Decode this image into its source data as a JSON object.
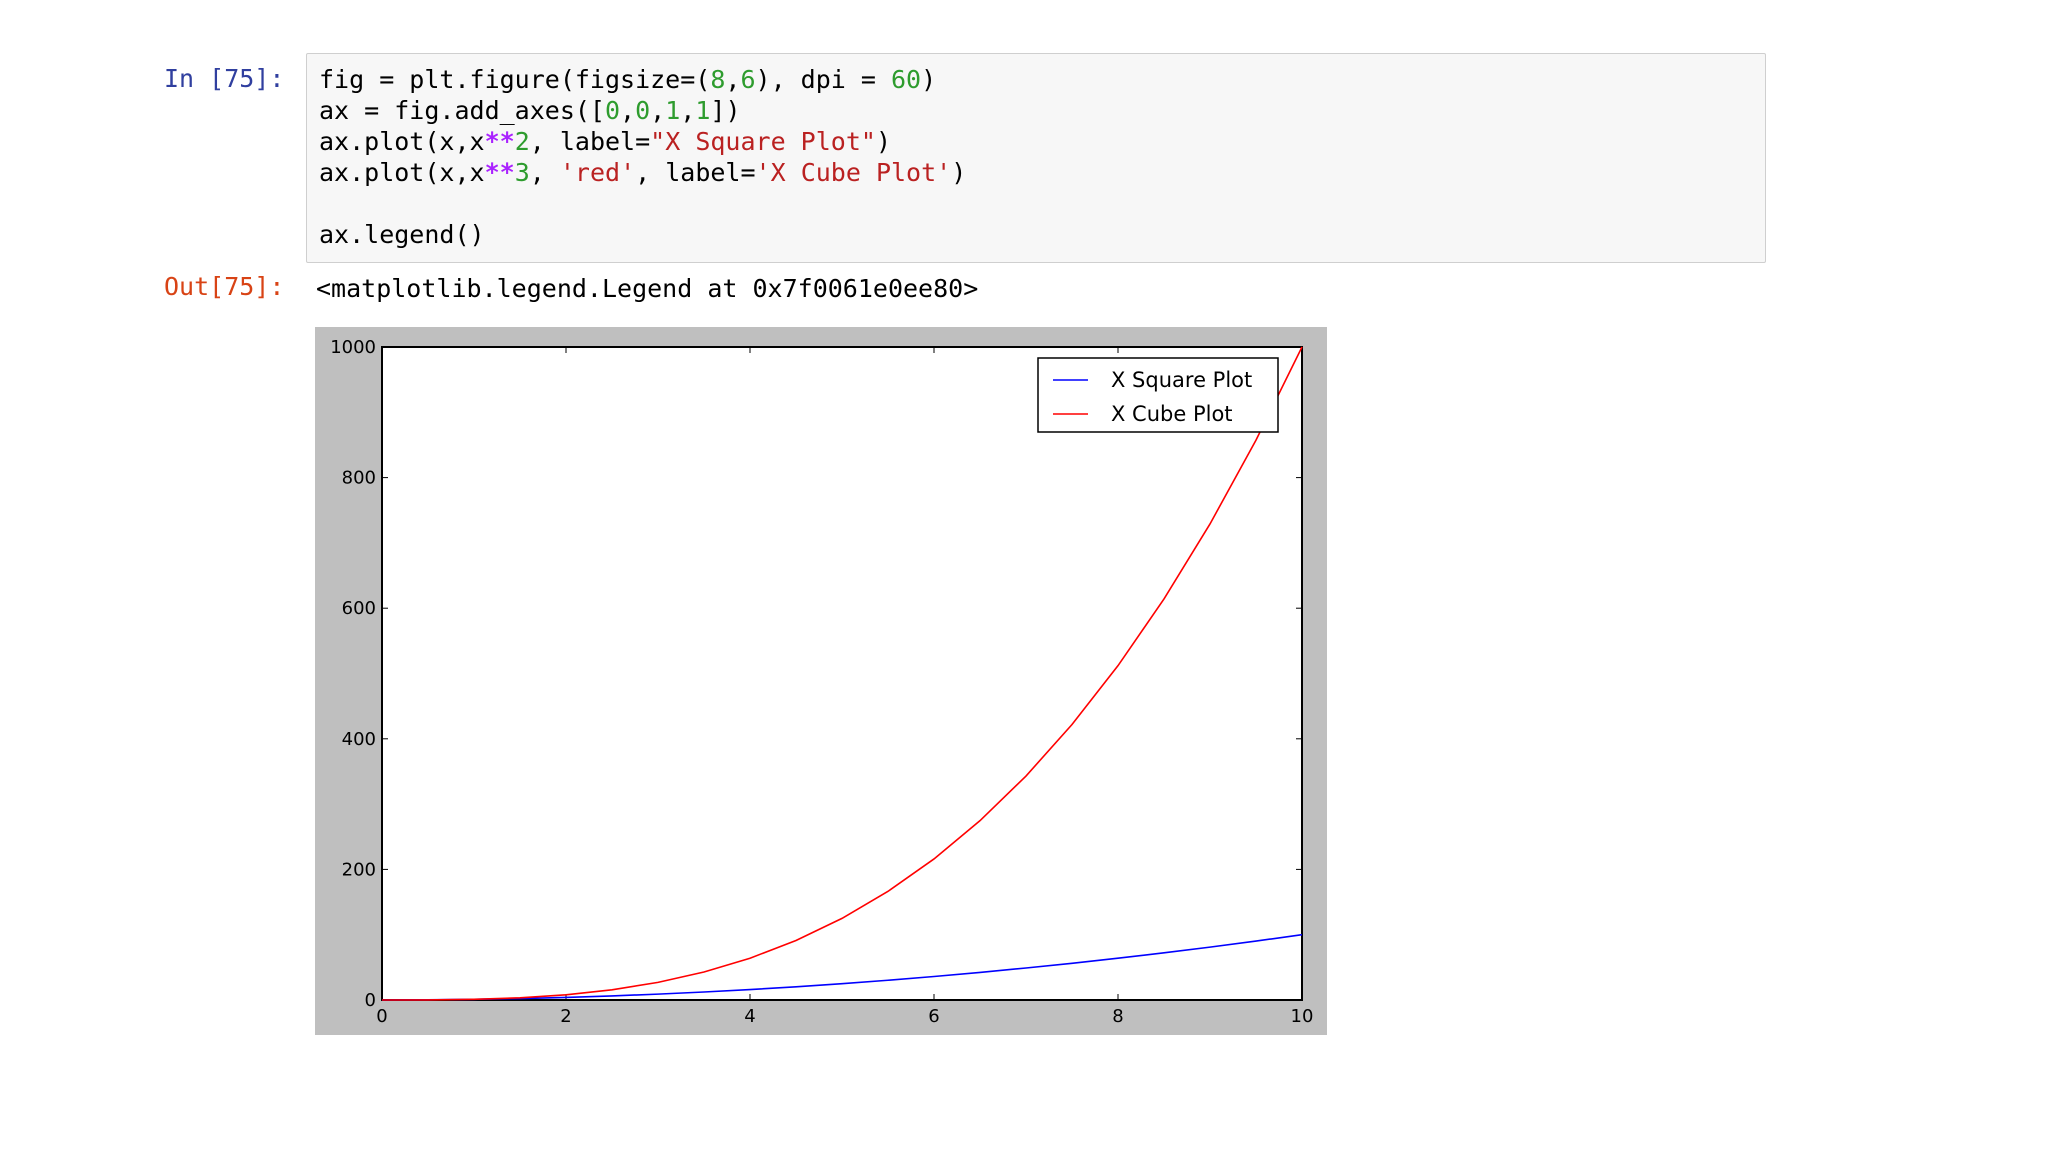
{
  "notebook": {
    "in_prompt": "In [75]:",
    "out_prompt": "Out[75]:",
    "code_lines": [
      [
        {
          "t": "fig = plt.figure(figsize=("
        },
        {
          "t": "8",
          "c": "num"
        },
        {
          "t": ","
        },
        {
          "t": "6",
          "c": "num"
        },
        {
          "t": "), dpi = "
        },
        {
          "t": "60",
          "c": "num"
        },
        {
          "t": ")"
        }
      ],
      [
        {
          "t": "ax = fig.add_axes(["
        },
        {
          "t": "0",
          "c": "num"
        },
        {
          "t": ","
        },
        {
          "t": "0",
          "c": "num"
        },
        {
          "t": ","
        },
        {
          "t": "1",
          "c": "num"
        },
        {
          "t": ","
        },
        {
          "t": "1",
          "c": "num"
        },
        {
          "t": "])"
        }
      ],
      [
        {
          "t": "ax.plot(x,x"
        },
        {
          "t": "**",
          "c": "op"
        },
        {
          "t": "2",
          "c": "num"
        },
        {
          "t": ", label="
        },
        {
          "t": "\"X Square Plot\"",
          "c": "str"
        },
        {
          "t": ")"
        }
      ],
      [
        {
          "t": "ax.plot(x,x"
        },
        {
          "t": "**",
          "c": "op"
        },
        {
          "t": "3",
          "c": "num"
        },
        {
          "t": ", "
        },
        {
          "t": "'red'",
          "c": "str"
        },
        {
          "t": ", label="
        },
        {
          "t": "'X Cube Plot'",
          "c": "str"
        },
        {
          "t": ")"
        }
      ],
      [
        {
          "t": ""
        }
      ],
      [
        {
          "t": "ax.legend()"
        }
      ]
    ],
    "output_text": "<matplotlib.legend.Legend at 0x7f0061e0ee80>"
  },
  "colors": {
    "blue": "#0000ff",
    "red": "#ff0000",
    "figure_bg": "#bfbfbf"
  },
  "chart_data": {
    "type": "line",
    "title": "",
    "xlabel": "",
    "ylabel": "",
    "xlim": [
      0,
      10
    ],
    "ylim": [
      0,
      1000
    ],
    "x_ticks": [
      0,
      2,
      4,
      6,
      8,
      10
    ],
    "y_ticks": [
      0,
      200,
      400,
      600,
      800,
      1000
    ],
    "x": [
      0,
      0.5,
      1,
      1.5,
      2,
      2.5,
      3,
      3.5,
      4,
      4.5,
      5,
      5.5,
      6,
      6.5,
      7,
      7.5,
      8,
      8.5,
      9,
      9.5,
      10
    ],
    "series": [
      {
        "name": "X Square Plot",
        "color": "#0000ff",
        "values": [
          0,
          0.25,
          1,
          2.25,
          4,
          6.25,
          9,
          12.25,
          16,
          20.25,
          25,
          30.25,
          36,
          42.25,
          49,
          56.25,
          64,
          72.25,
          81,
          90.25,
          100
        ]
      },
      {
        "name": "X Cube Plot",
        "color": "#ff0000",
        "values": [
          0,
          0.125,
          1,
          3.375,
          8,
          15.625,
          27,
          42.875,
          64,
          91.125,
          125,
          166.375,
          216,
          274.625,
          343,
          421.875,
          512,
          614.125,
          729,
          857.375,
          1000
        ]
      }
    ],
    "legend": {
      "position": "upper-right"
    },
    "grid": false
  }
}
